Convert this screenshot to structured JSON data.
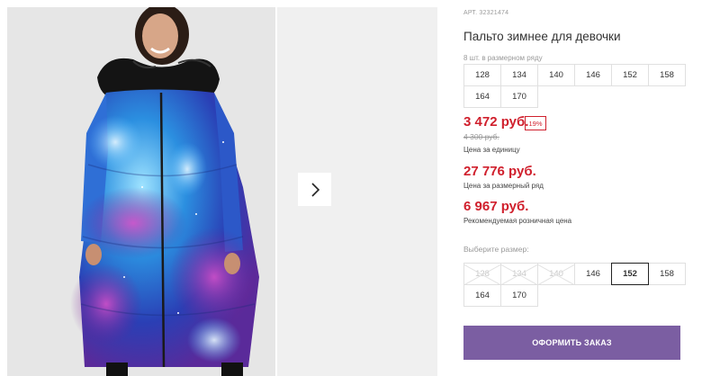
{
  "product": {
    "article": "АРТ. 32321474",
    "title": "Пальто зимнее для девочки",
    "row_note": "8 шт. в размерном ряду",
    "sizes_row": [
      "128",
      "134",
      "140",
      "146",
      "152",
      "158",
      "164",
      "170"
    ],
    "price": "3 472 руб.",
    "discount": "19%",
    "old_price": "4 300 руб.",
    "price_unit_label": "Цена за единицу",
    "row_price": "27 776 руб.",
    "row_price_label": "Цена за размерный ряд",
    "retail_price": "6 967 руб.",
    "retail_price_label": "Рекомендуемая розничная цена"
  },
  "size_select": {
    "label": "Выберите размер:",
    "options": [
      {
        "label": "128",
        "state": "disabled"
      },
      {
        "label": "134",
        "state": "disabled"
      },
      {
        "label": "140",
        "state": "disabled"
      },
      {
        "label": "146",
        "state": "available"
      },
      {
        "label": "152",
        "state": "selected"
      },
      {
        "label": "158",
        "state": "available"
      },
      {
        "label": "164",
        "state": "available"
      },
      {
        "label": "170",
        "state": "available"
      }
    ]
  },
  "order_button": "ОФОРМИТЬ ЗАКАЗ",
  "gallery": {
    "next_icon": "chevron-right-icon"
  },
  "colors": {
    "price_red": "#d0202d",
    "button_purple": "#7b5ea2"
  }
}
